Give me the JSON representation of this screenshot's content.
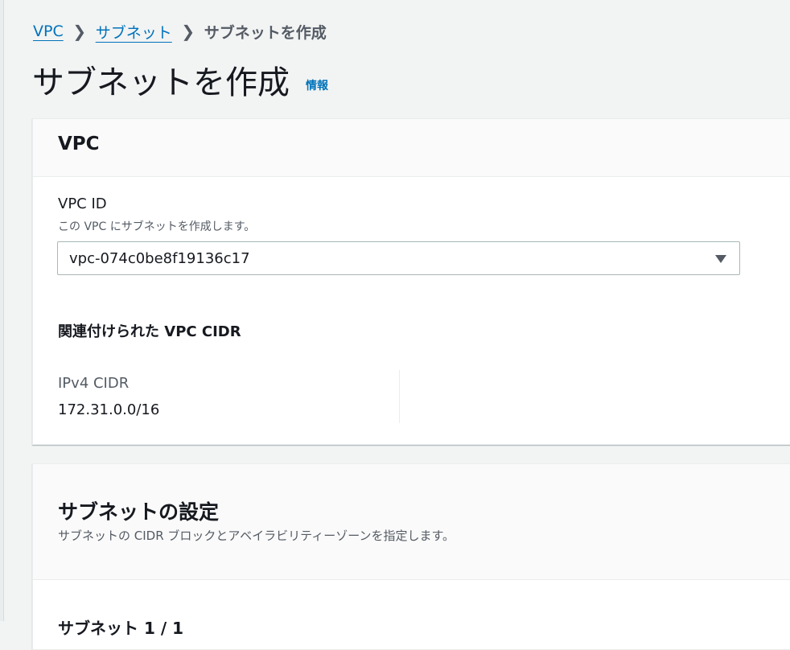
{
  "breadcrumb": {
    "items": [
      {
        "label": "VPC"
      },
      {
        "label": "サブネット"
      }
    ],
    "separator": "❯",
    "current": "サブネットを作成"
  },
  "page": {
    "title": "サブネットを作成",
    "info_link": "情報"
  },
  "vpc_panel": {
    "title": "VPC",
    "vpc_id_label": "VPC ID",
    "vpc_id_description": "この VPC にサブネットを作成します。",
    "vpc_id_value": "vpc-074c0be8f19136c17",
    "cidr_heading": "関連付けられた VPC CIDR",
    "ipv4_cidr_label": "IPv4 CIDR",
    "ipv4_cidr_value": "172.31.0.0/16"
  },
  "subnet_panel": {
    "title": "サブネットの設定",
    "description": "サブネットの CIDR ブロックとアベイラビリティーゾーンを指定します。",
    "next_section_title": "サブネット 1 / 1"
  },
  "icons": {
    "select_caret": "caret-down-icon",
    "breadcrumb_separator": "chevron-right-icon"
  },
  "colors": {
    "link": "#0073bb",
    "text": "#16191f",
    "secondary_text": "#545b64",
    "background": "#f2f3f3"
  }
}
